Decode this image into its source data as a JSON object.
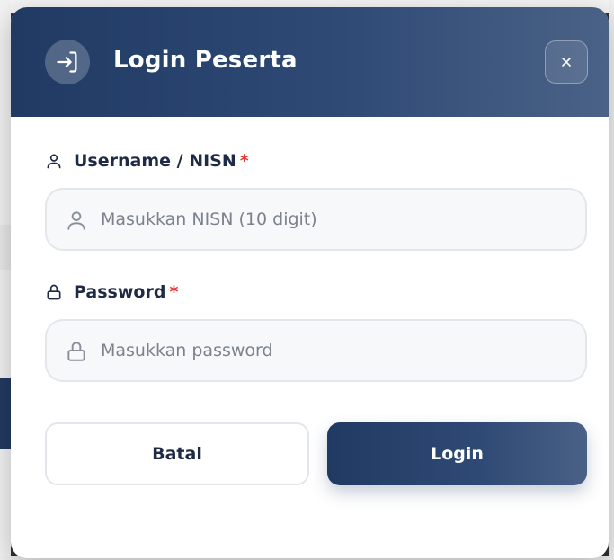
{
  "modal": {
    "title": "Login Peserta",
    "header_icon": "login-arrow-icon",
    "close_icon": "close-icon",
    "close_symbol": "×"
  },
  "fields": {
    "username": {
      "label": "Username / NISN",
      "required_mark": "*",
      "icon": "user-icon",
      "value": "",
      "placeholder": "Masukkan NISN (10 digit)"
    },
    "password": {
      "label": "Password",
      "required_mark": "*",
      "icon": "lock-icon",
      "value": "",
      "placeholder": "Masukkan password"
    }
  },
  "buttons": {
    "cancel": "Batal",
    "login": "Login"
  },
  "colors": {
    "header_start": "#203a63",
    "header_end": "#4b6287",
    "required": "#e53935",
    "text_dark": "#1f2a44",
    "placeholder": "#7b828e"
  }
}
